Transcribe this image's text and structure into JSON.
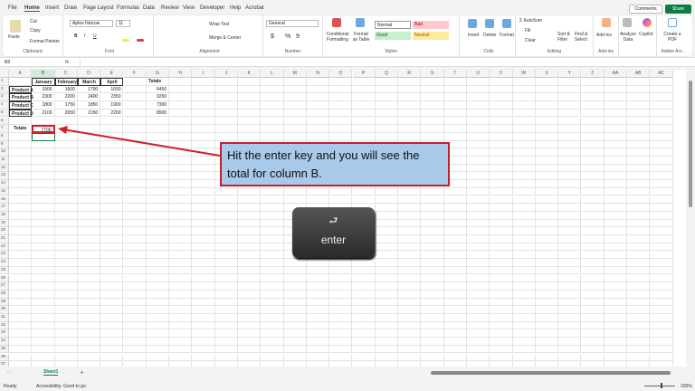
{
  "menu": {
    "tabs": [
      "File",
      "Home",
      "Insert",
      "Draw",
      "Page Layout",
      "Formulas",
      "Data",
      "Review",
      "View",
      "Developer",
      "Help",
      "Acrobat"
    ],
    "comments": "Comments",
    "share": "Share"
  },
  "ribbon": {
    "clipboard": {
      "label": "Clipboard",
      "paste": "Paste",
      "cut": "Cut",
      "copy": "Copy",
      "format_painter": "Format Painter"
    },
    "font": {
      "label": "Font",
      "name": "Aptos Narrow",
      "size": "11",
      "bold": "B",
      "italic": "I",
      "underline": "U"
    },
    "alignment": {
      "label": "Alignment",
      "wrap": "Wrap Text",
      "merge": "Merge & Center"
    },
    "number": {
      "label": "Number",
      "format": "General",
      "currency": "$",
      "percent": "%",
      "comma": "9"
    },
    "styles": {
      "label": "Styles",
      "conditional": "Conditional Formatting",
      "format_table": "Format as Table",
      "normal": "Normal",
      "bad": "Bad",
      "good": "Good",
      "neutral": "Neutral"
    },
    "cells": {
      "label": "Cells",
      "insert": "Insert",
      "delete": "Delete",
      "format": "Format"
    },
    "editing": {
      "label": "Editing",
      "autosum": "AutoSum",
      "fill": "Fill",
      "clear": "Clear",
      "sort": "Sort & Filter",
      "find": "Find & Select"
    },
    "addins": {
      "label": "Add-ins",
      "addins": "Add-ins"
    },
    "ai": {
      "analyze": "Analyze Data",
      "copilot": "Copilot"
    },
    "adobe": {
      "label": "Adobe Acr...",
      "create": "Create a PDF"
    }
  },
  "formula_bar": {
    "name_box": "B8",
    "fx": "fx",
    "value": ""
  },
  "columns": [
    "A",
    "B",
    "C",
    "D",
    "E",
    "F",
    "G",
    "H",
    "I",
    "J",
    "K",
    "L",
    "M",
    "N",
    "O",
    "P",
    "Q",
    "R",
    "S",
    "T",
    "U",
    "V",
    "W",
    "X",
    "Y",
    "Z",
    "AA",
    "AB",
    "AC"
  ],
  "row_count": 37,
  "cells": {
    "B1": "January",
    "C1": "February",
    "D1": "March",
    "E1": "April",
    "G1": "Totals",
    "A2": "Product A",
    "B2": "1500",
    "C2": "1600",
    "D2": "1700",
    "E2": "1650",
    "G2": "6450",
    "A3": "Product B",
    "B3": "2300",
    "C3": "2200",
    "D3": "2400",
    "E3": "2350",
    "G3": "9250",
    "A4": "Product C",
    "B4": "1800",
    "C4": "1750",
    "D4": "1850",
    "E4": "1900",
    "G4": "7300",
    "A5": "Product D",
    "B5": "2100",
    "C5": "2050",
    "D5": "2150",
    "E5": "2200",
    "G5": "8500",
    "A7": "Totals",
    "B7": "7700"
  },
  "sheet_tabs": [
    "Sheet1"
  ],
  "status": {
    "ready": "Ready",
    "accessibility": "Accessibility: Good to go",
    "zoom": "100%"
  },
  "callout": {
    "text": "Hit the enter key and you will see the total for column B."
  },
  "enter_key": {
    "symbol": "⮐",
    "label": "enter"
  },
  "colors": {
    "accent": "#107c41",
    "callout_bg": "#a8c9ea",
    "callout_border": "#c0202a"
  }
}
